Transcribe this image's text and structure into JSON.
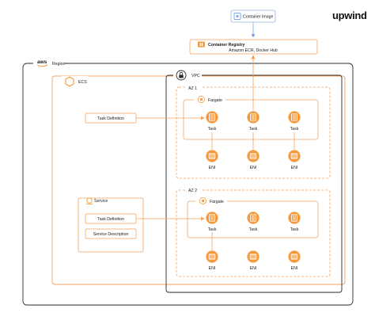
{
  "brand": {
    "name": "upwind"
  },
  "colors": {
    "orange": "#f5a25d",
    "orange_icon": "#f59a3c",
    "blue": "#7aa7e6",
    "dark": "#2b2b2b",
    "gray": "#9a9a9a",
    "chip_border": "#9bb3d8"
  },
  "container_image": {
    "label": "Container Image",
    "icon": "container-image-icon"
  },
  "registry": {
    "title": "Container Registry",
    "subtitle": "Amazon ECR, Docker Hub",
    "icon": "container-registry-icon"
  },
  "aws": {
    "logo_text": "aws",
    "region_label": "Region"
  },
  "ecs": {
    "label": "ECS",
    "icon": "ecs-hexagon-icon"
  },
  "vpc": {
    "label": "VPC",
    "icon": "lock-icon"
  },
  "az1": {
    "label": "AZ 1",
    "fargate_label": "Fargate",
    "tasks": [
      "Task",
      "Task",
      "Task"
    ],
    "enis": [
      "ENI",
      "ENI",
      "ENI"
    ]
  },
  "az2": {
    "label": "AZ 2",
    "fargate_label": "Fargate",
    "tasks": [
      "Task",
      "Task",
      "Task"
    ],
    "enis": [
      "ENI",
      "ENI",
      "ENI"
    ]
  },
  "task_definition_1": "Task Definition",
  "service": {
    "label": "Service",
    "task_definition": "Task Definition",
    "description": "Service Description"
  }
}
